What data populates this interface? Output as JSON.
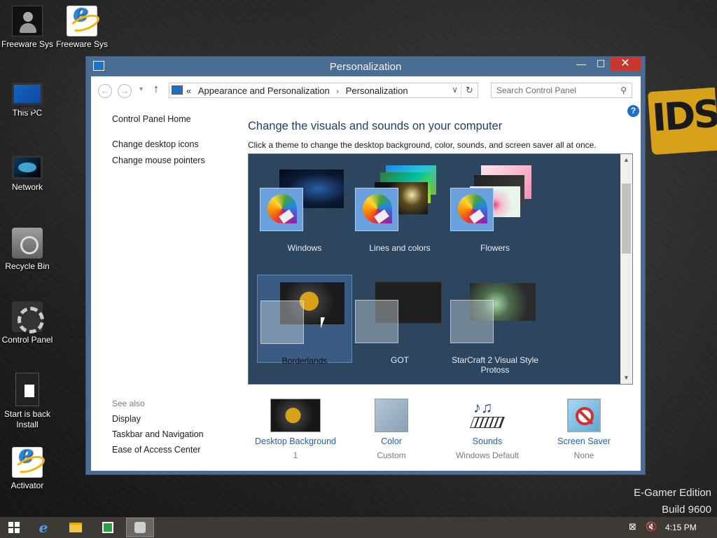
{
  "desktop": {
    "icons": [
      {
        "label": "Freeware Sys",
        "icon": "user-icon"
      },
      {
        "label": "Freeware Sys",
        "icon": "internet-explorer-icon"
      },
      {
        "label": "This PC",
        "icon": "computer-icon"
      },
      {
        "label": "Network",
        "icon": "network-icon"
      },
      {
        "label": "Recycle Bin",
        "icon": "recycle-bin-icon"
      },
      {
        "label": "Control Panel",
        "icon": "control-panel-icon"
      },
      {
        "label_line1": "Start is back",
        "label_line2": "Install",
        "icon": "installer-icon"
      },
      {
        "label": "Activator",
        "icon": "internet-explorer-icon"
      }
    ],
    "watermark": {
      "line1": "E-Gamer Edition",
      "line2": "Build 9600"
    }
  },
  "window": {
    "title": "Personalization",
    "controls": {
      "minimize": "—",
      "maximize": "☐",
      "close": "✕"
    },
    "address": {
      "prefix": "«",
      "crumbs": [
        "Appearance and Personalization",
        "Personalization"
      ],
      "separator": "›"
    },
    "search": {
      "placeholder": "Search Control Panel"
    },
    "help_label": "?",
    "left_pane": {
      "home": "Control Panel Home",
      "links": [
        "Change desktop icons",
        "Change mouse pointers"
      ]
    },
    "see_also": {
      "title": "See also",
      "links": [
        "Display",
        "Taskbar and Navigation",
        "Ease of Access Center"
      ]
    },
    "main": {
      "heading": "Change the visuals and sounds on your computer",
      "subheading": "Click a theme to change the desktop background, color, sounds, and screen saver all at once.",
      "themes_row1": [
        {
          "name": "Windows"
        },
        {
          "name": "Lines and colors"
        },
        {
          "name": "Flowers"
        }
      ],
      "themes_row2": [
        {
          "name": "Borderlands",
          "selected": true
        },
        {
          "name": "GOT"
        },
        {
          "name_line1": "StarCraft 2 Visual Style",
          "name_line2": "Protoss"
        }
      ]
    },
    "settings": [
      {
        "label": "Desktop Background",
        "value": "1",
        "icon": "desktop-background-icon"
      },
      {
        "label": "Color",
        "value": "Custom",
        "icon": "color-swatch-icon"
      },
      {
        "label": "Sounds",
        "value": "Windows Default",
        "icon": "sounds-icon"
      },
      {
        "label": "Screen Saver",
        "value": "None",
        "icon": "screen-saver-icon"
      }
    ]
  },
  "taskbar": {
    "clock": "4:15 PM",
    "items": [
      "start-icon",
      "internet-explorer-icon",
      "file-explorer-icon",
      "store-icon",
      "personalization-icon"
    ]
  },
  "colors": {
    "window_frame": "#4a6e93",
    "close_button": "#c7372f",
    "link_blue": "#1d5fb6",
    "heading_blue": "#1e3f66",
    "taskbar": "#3d3a36"
  }
}
